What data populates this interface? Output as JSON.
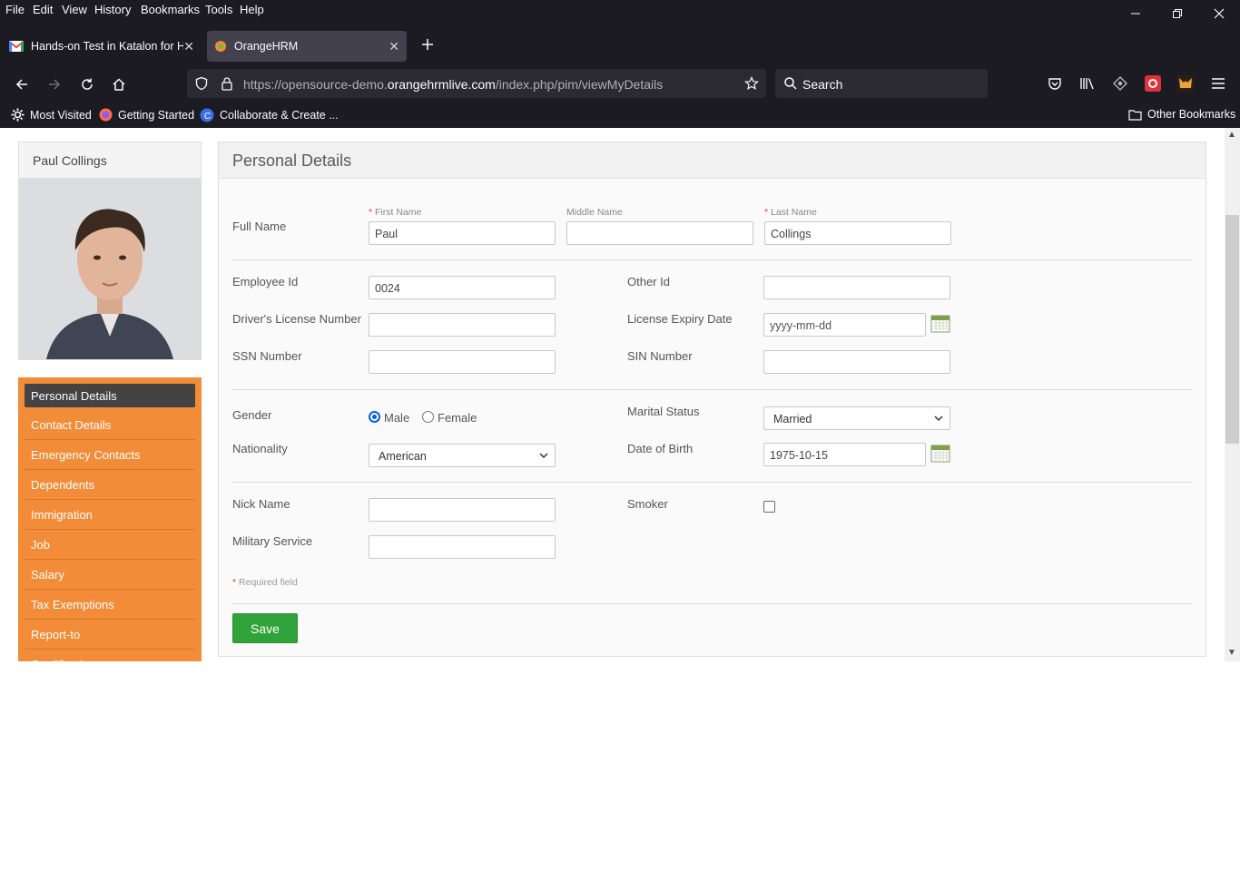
{
  "menu": [
    "File",
    "Edit",
    "View",
    "History",
    "Bookmarks",
    "Tools",
    "Help"
  ],
  "tabs": [
    {
      "label": "Hands-on Test in Katalon for He"
    },
    {
      "label": "OrangeHRM"
    }
  ],
  "url": {
    "prefix": "https://opensource-demo.",
    "domain": "orangehrmlive.com",
    "path": "/index.php/pim/viewMyDetails"
  },
  "search": {
    "placeholder": "Search"
  },
  "bookmarks": {
    "most_visited": "Most Visited",
    "getting_started": "Getting Started",
    "collaborate": "Collaborate & Create ...",
    "other": "Other Bookmarks"
  },
  "profile": {
    "name": "Paul Collings"
  },
  "side_menu": [
    "Personal Details",
    "Contact Details",
    "Emergency Contacts",
    "Dependents",
    "Immigration",
    "Job",
    "Salary",
    "Tax Exemptions",
    "Report-to",
    "Qualifications"
  ],
  "form": {
    "title": "Personal Details",
    "full_name_label": "Full Name",
    "first_name_label": "First Name",
    "middle_name_label": "Middle Name",
    "last_name_label": "Last Name",
    "first_name": "Paul",
    "middle_name": "",
    "last_name": "Collings",
    "employee_id_label": "Employee Id",
    "employee_id": "0024",
    "other_id_label": "Other Id",
    "other_id": "",
    "license_label": "Driver's License Number",
    "license": "",
    "license_expiry_label": "License Expiry Date",
    "license_expiry": "yyyy-mm-dd",
    "ssn_label": "SSN Number",
    "ssn": "",
    "sin_label": "SIN Number",
    "sin": "",
    "gender_label": "Gender",
    "male_label": "Male",
    "female_label": "Female",
    "gender_selected": "Male",
    "marital_label": "Marital Status",
    "marital_value": "Married",
    "nationality_label": "Nationality",
    "nationality_value": "American",
    "dob_label": "Date of Birth",
    "dob": "1975-10-15",
    "nick_label": "Nick Name",
    "nick": "",
    "smoker_label": "Smoker",
    "smoker_checked": false,
    "military_label": "Military Service",
    "military": "",
    "required_note": "Required field",
    "required_mark": "*",
    "save_label": "Save"
  },
  "colors": {
    "accent_orange": "#f28c38",
    "save_green": "#30a33a",
    "chrome_dark": "#1c1b22"
  }
}
